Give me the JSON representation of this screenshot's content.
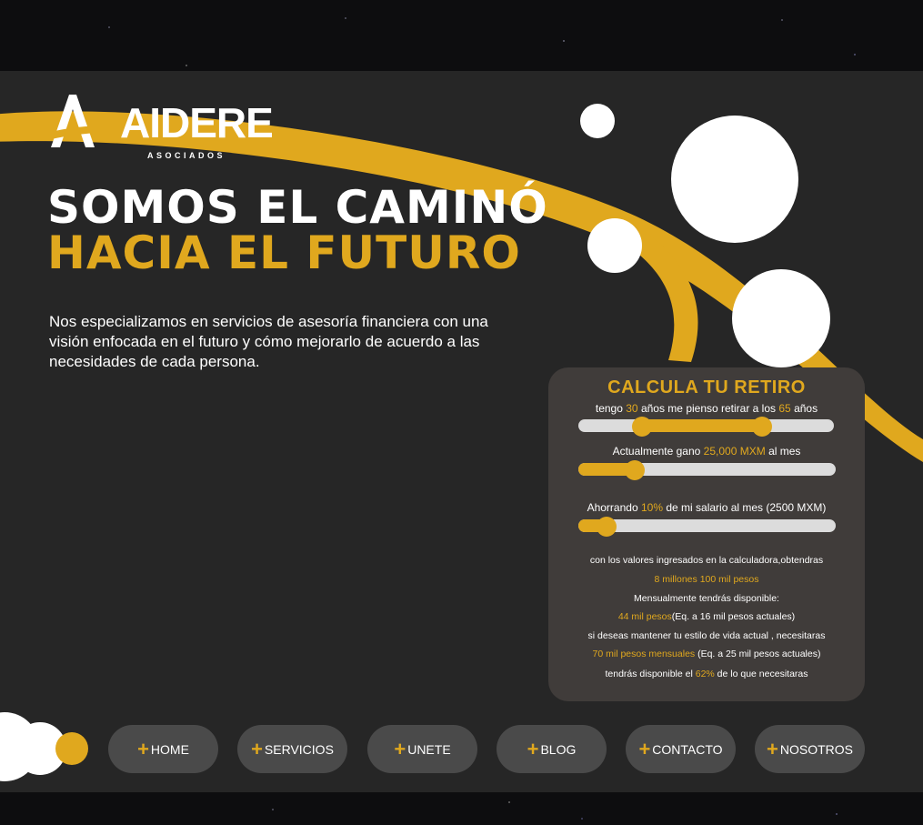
{
  "brand": {
    "name": "AIDERE",
    "subtitle": "ASOCIADOS"
  },
  "hero": {
    "line1": "SOMOS EL CAMINÓ",
    "line2": "HACIA EL FUTURO"
  },
  "description": "Nos especializamos en servicios de asesoría financiera con una visión enfocada en el futuro y cómo mejorarlo de acuerdo a las necesidades de cada persona.",
  "calculator": {
    "title": "CALCULA TU RETIRO",
    "age_prefix": "tengo",
    "current_age": "30",
    "age_middle": "años me pienso retirar a los",
    "retire_age": "65",
    "age_suffix": "años",
    "age_range": {
      "min_fraction": 0.25,
      "max_fraction": 0.72
    },
    "salary_prefix": "Actualmente gano",
    "salary_value": "25,000  MXM",
    "salary_suffix": "al mes",
    "salary_fraction": 0.18,
    "saving_prefix": "Ahorrando",
    "saving_value": "10%",
    "saving_suffix": "de mi salario al mes   (2500 MXM)",
    "saving_fraction": 0.07,
    "results": {
      "line1": "con los valores ingresados en la calculadora,obtendras",
      "total": "8 millones 100 mil pesos",
      "line3": "Mensualmente tendrás disponible:",
      "monthly_value": "44 mil pesos",
      "monthly_note": "(Eq. a 16 mil pesos actuales)",
      "line5": "si deseas mantener tu estilo de vida actual , necesitaras",
      "needed_value": "70 mil pesos mensuales",
      "needed_note": " (Eq. a 25 mil pesos actuales)",
      "coverage_prefix": "tendrás disponible el",
      "coverage_value": "62%",
      "coverage_suffix": "de lo que necesitaras"
    }
  },
  "nav": [
    {
      "label": "HOME"
    },
    {
      "label": "SERVICIOS"
    },
    {
      "label": "UNETE"
    },
    {
      "label": "BLOG"
    },
    {
      "label": "CONTACTO"
    },
    {
      "label": "NOSOTROS"
    }
  ],
  "colors": {
    "accent": "#e0a81e",
    "panel": "#262626",
    "calculator_bg": "#403c3a",
    "button_bg": "#4a4a4a"
  }
}
